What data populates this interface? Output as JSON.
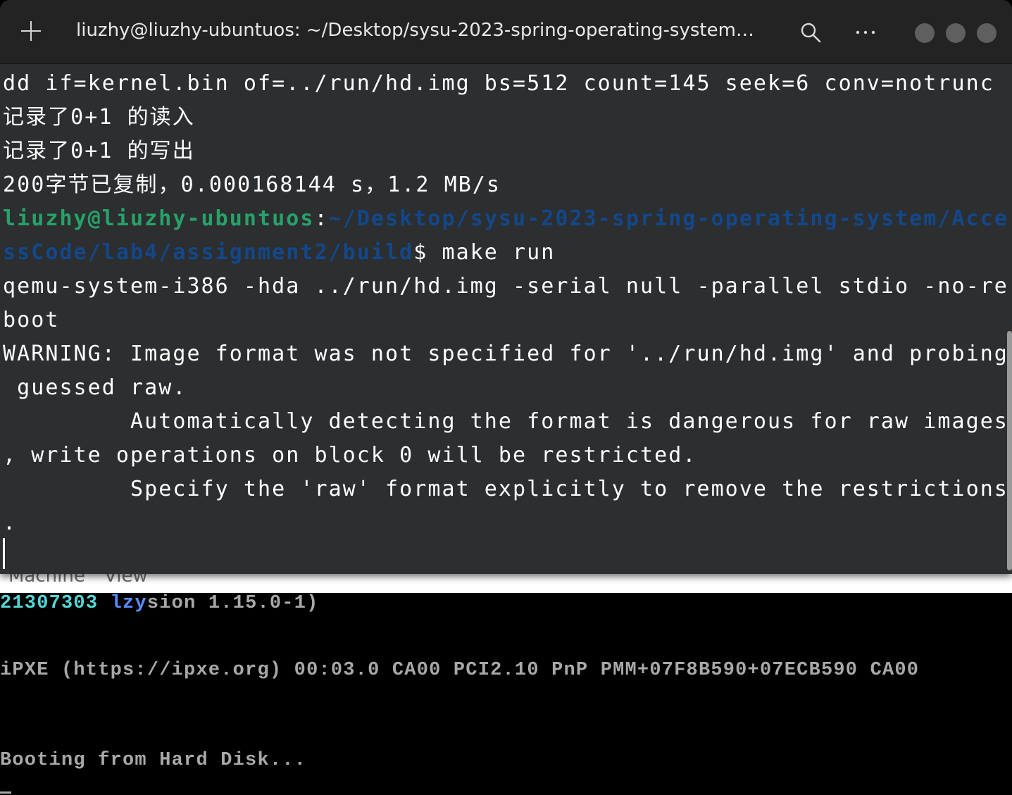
{
  "qemu": {
    "menu": [
      "Machine",
      "View"
    ],
    "screen": {
      "line1_id": "21307303",
      "line1_name_a": "lzy",
      "line1_name_b": "sion 1.15.0-1)",
      "line2": "iPXE (https://ipxe.org) 00:03.0 CA00 PCI2.10 PnP PMM+07F8B590+07ECB590 CA00",
      "line3": "Booting from Hard Disk..."
    }
  },
  "terminal": {
    "title": "liuzhy@liuzhy-ubuntuos: ~/Desktop/sysu-2023-spring-operating-system…",
    "lines": [
      "dd if=kernel.bin of=../run/hd.img bs=512 count=145 seek=6 conv=notrunc",
      "记录了0+1 的读入",
      "记录了0+1 的写出",
      "200字节已复制，0.000168144 s，1.2 MB/s"
    ],
    "prompt": {
      "user": "liuzhy@liuzhy-ubuntuos",
      "colon": ":",
      "path_line1": "~/Desktop/sysu-2023-spring-operating-system/Acce",
      "path_line2": "ssCode/lab4/assignment2/build",
      "command": "$ make run"
    },
    "output": [
      "qemu-system-i386 -hda ../run/hd.img -serial null -parallel stdio -no-re",
      "boot",
      "WARNING: Image format was not specified for '../run/hd.img' and probing",
      " guessed raw.",
      "         Automatically detecting the format is dangerous for raw images",
      ", write operations on block 0 will be restricted.",
      "         Specify the 'raw' format explicitly to remove the restrictions",
      "."
    ]
  },
  "colors": {
    "terminal_bg": "#2c2e30",
    "prompt_user": "#26a269",
    "prompt_path": "#12488b",
    "qemu_text": "#a8a8a8",
    "qemu_cyan": "#54d6d6",
    "qemu_blue": "#5c8cff"
  },
  "icons": [
    "new-tab-icon",
    "search-icon",
    "menu-icon",
    "minimize-icon",
    "maximize-icon",
    "close-icon"
  ]
}
